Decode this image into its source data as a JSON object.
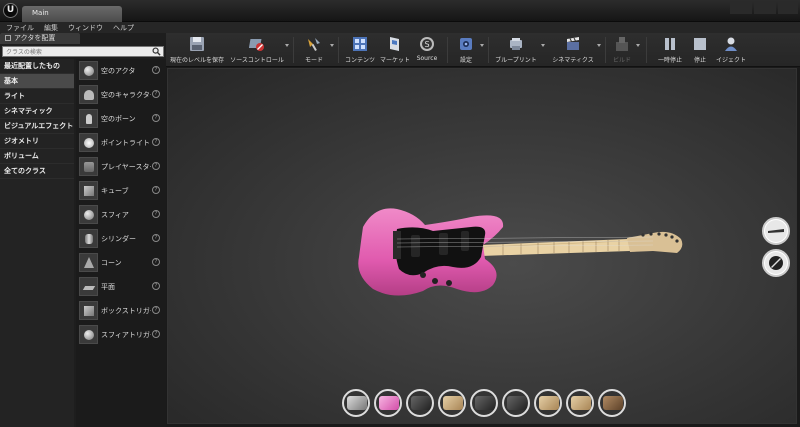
{
  "window": {
    "logo": "U",
    "tab_title": "Main"
  },
  "menu": [
    "ファイル",
    "編集",
    "ウィンドウ",
    "ヘルプ"
  ],
  "left_panel": {
    "tab_title": "アクタを配置",
    "search_placeholder": "クラスの検索",
    "categories": [
      "最近配置したもの",
      "基本",
      "ライト",
      "シネマティック",
      "ビジュアルエフェクト",
      "ジオメトリ",
      "ボリューム",
      "全てのクラス"
    ],
    "selected_category": "基本",
    "actors": [
      {
        "label": "空のアクタ",
        "icon": "sphere-icon"
      },
      {
        "label": "空のキャラクター",
        "icon": "character-icon"
      },
      {
        "label": "空のポーン",
        "icon": "pawn-icon"
      },
      {
        "label": "ポイントライト",
        "icon": "point-light-icon"
      },
      {
        "label": "プレイヤースター|",
        "icon": "player-start-icon"
      },
      {
        "label": "キューブ",
        "icon": "cube-icon"
      },
      {
        "label": "スフィア",
        "icon": "sphere-icon"
      },
      {
        "label": "シリンダー",
        "icon": "cylinder-icon"
      },
      {
        "label": "コーン",
        "icon": "cone-icon"
      },
      {
        "label": "平面",
        "icon": "plane-icon"
      },
      {
        "label": "ボックストリガー",
        "icon": "box-trigger-icon"
      },
      {
        "label": "スフィアトリガー",
        "icon": "sphere-trigger-icon"
      }
    ]
  },
  "toolbar": {
    "save_level": "現在のレベルを保存",
    "source_control": "ソースコントロール",
    "modes": "モード",
    "content": "コンテンツ",
    "marketplace": "マーケット",
    "source": "Source",
    "settings": "設定",
    "blueprints": "ブループリント",
    "cinematics": "シネマティクス",
    "build": "ビルド",
    "pause": "一時停止",
    "stop": "停止",
    "eject": "イジェクト"
  },
  "viewport": {
    "guitar_body_color": "#e05aae",
    "side_buttons": [
      "pickguard-tool-icon",
      "material-tool-icon"
    ],
    "material_swatches": [
      "silver",
      "pink",
      "dark",
      "wood",
      "dark",
      "dark",
      "wood",
      "wood",
      "brown"
    ]
  }
}
